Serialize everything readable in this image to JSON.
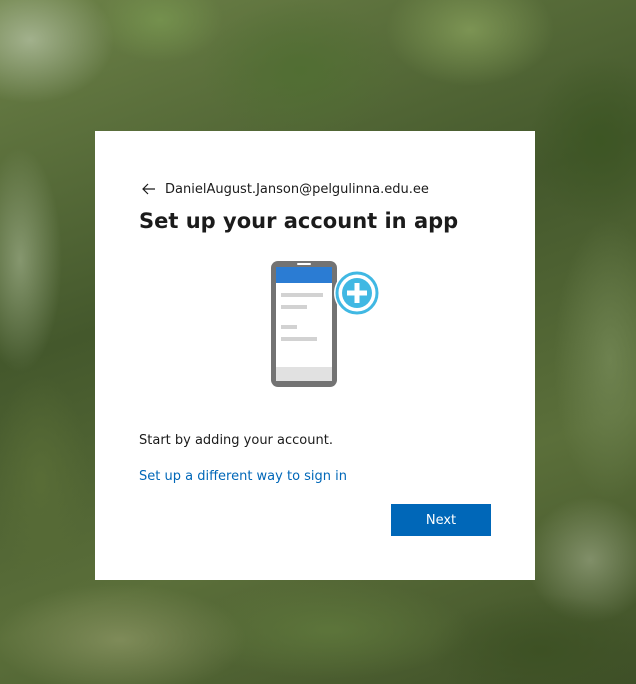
{
  "identity": {
    "email": "DanielAugust.Janson@pelgulinna.edu.ee",
    "back_icon": "arrow-left-icon"
  },
  "main": {
    "title": "Set up your account in app",
    "illustration_icon": "phone-add-account-icon",
    "description": "Start by adding your account.",
    "alt_link": "Set up a different way to sign in",
    "next_label": "Next"
  },
  "colors": {
    "accent": "#0067b8",
    "phone_frame": "#737373",
    "phone_header": "#2b7cd3",
    "plus_circle": "#40b8e3"
  }
}
